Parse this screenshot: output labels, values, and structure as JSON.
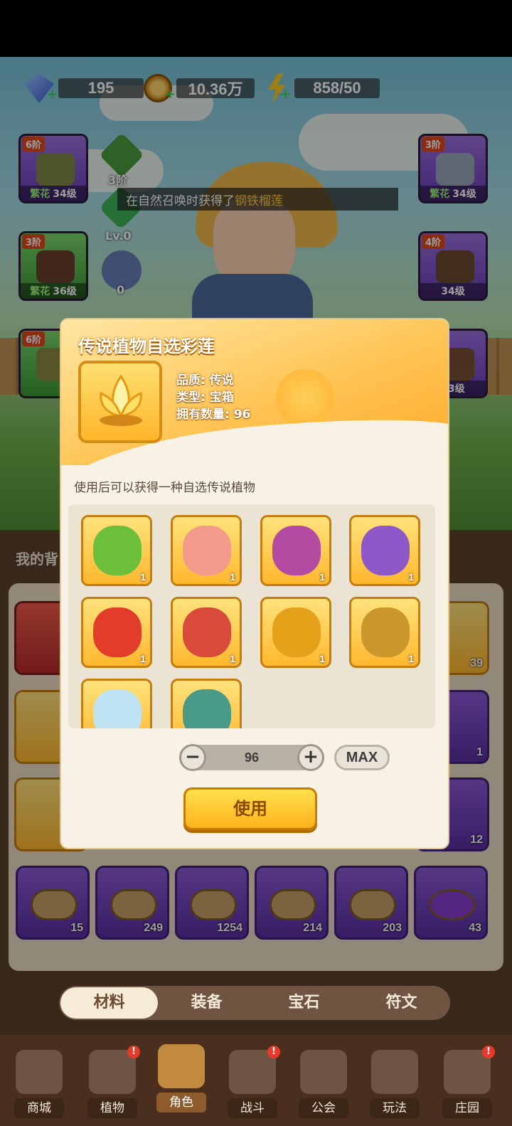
{
  "resources": {
    "gems": "195",
    "coins": "10.36万",
    "energy": "858/50"
  },
  "notice": {
    "prefix": "在自然召唤时获得了",
    "highlight": "钢铁榴莲"
  },
  "slots": [
    {
      "tier": "6阶",
      "quality": "繁花",
      "level": "34级"
    },
    {
      "tier": "3阶",
      "quality": "繁花",
      "level": "36级"
    },
    {
      "tier": "6阶",
      "quality": "",
      "level": ""
    },
    {
      "tier": "3阶",
      "quality": "繁花",
      "level": "34级"
    },
    {
      "tier": "4阶",
      "quality": "",
      "level": "34级"
    },
    {
      "tier": "",
      "quality": "",
      "level": "33级"
    }
  ],
  "mini": {
    "tier": "3阶",
    "lv": "Lv.0",
    "count": "0"
  },
  "modal": {
    "title": "传说植物自选彩莲",
    "quality": "品质: 传说",
    "type": "类型: 宝箱",
    "owned": "拥有数量: 96",
    "description": "使用后可以获得一种自选传说植物",
    "options": [
      "1",
      "1",
      "1",
      "1",
      "1",
      "1",
      "1",
      "1",
      "",
      ""
    ],
    "quantity": "96",
    "max_label": "MAX",
    "use_label": "使用"
  },
  "inventory_counts": [
    "15",
    "249",
    "1254",
    "214",
    "203",
    "43"
  ],
  "side_counts": [
    "39",
    "1",
    "12"
  ],
  "tabs": [
    "材料",
    "装备",
    "宝石",
    "符文"
  ],
  "nav": [
    "商城",
    "植物",
    "角色",
    "战斗",
    "公会",
    "玩法",
    "庄园"
  ],
  "section_title": "我的背"
}
